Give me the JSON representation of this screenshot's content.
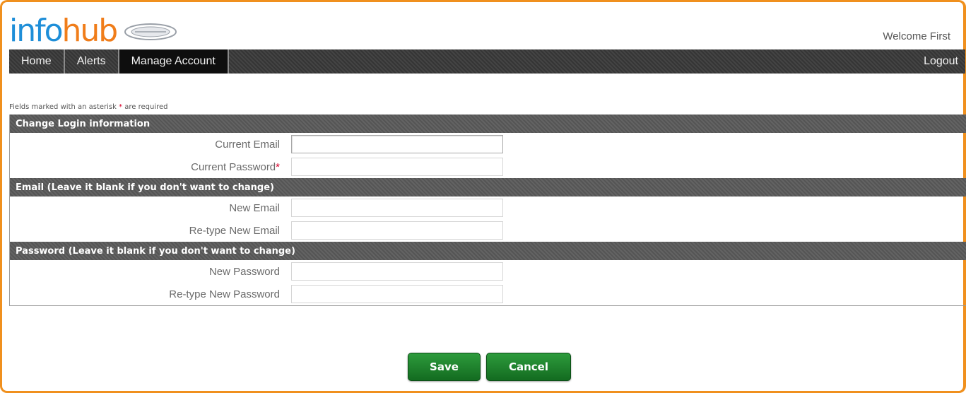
{
  "header": {
    "logo_info": "inf",
    "logo_o": "o",
    "logo_hub": "hub",
    "welcome": "Welcome First"
  },
  "nav": {
    "tabs": [
      {
        "label": "Home",
        "active": false
      },
      {
        "label": "Alerts",
        "active": false
      },
      {
        "label": "Manage Account",
        "active": true
      }
    ],
    "logout": "Logout"
  },
  "form": {
    "required_note_before": "Fields marked with an asterisk",
    "required_note_star": "*",
    "required_note_after": "are required",
    "sections": [
      {
        "title": "Change Login information",
        "fields": [
          {
            "label": "Current Email",
            "required": false,
            "value": ""
          },
          {
            "label": "Current Password",
            "required": true,
            "value": ""
          }
        ]
      },
      {
        "title": "Email (Leave it blank if you don't want to change)",
        "fields": [
          {
            "label": "New Email",
            "required": false,
            "value": ""
          },
          {
            "label": "Re-type New Email",
            "required": false,
            "value": ""
          }
        ]
      },
      {
        "title": "Password (Leave it blank if you don't want to change)",
        "fields": [
          {
            "label": "New Password",
            "required": false,
            "value": ""
          },
          {
            "label": "Re-type New Password",
            "required": false,
            "value": ""
          }
        ]
      }
    ],
    "star": "*"
  },
  "actions": {
    "save_label": "Save",
    "cancel_label": "Cancel"
  },
  "colors": {
    "frame_border": "#f0901e",
    "logo_info": "#1e8ed8",
    "logo_hub": "#f07d1a",
    "nav_bg": "#3a3a3a",
    "button_green": "#1c7a2a",
    "required_star": "#d8002a"
  }
}
